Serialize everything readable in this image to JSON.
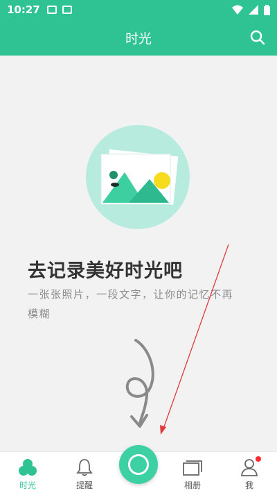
{
  "status_bar": {
    "time": "10:27",
    "icons": [
      "image-icon",
      "a-icon",
      "wifi-icon",
      "signal-icon",
      "battery-icon"
    ]
  },
  "app_bar": {
    "title": "时光",
    "search_icon": "search-icon"
  },
  "empty_state": {
    "illustration": "photo-placeholder-icon",
    "title": "去记录美好时光吧",
    "description": "一张张照片，一段文字，让你的记忆不再模糊"
  },
  "tabs": [
    {
      "label": "时光",
      "icon": "bubbles-icon",
      "active": true
    },
    {
      "label": "提醒",
      "icon": "bell-icon",
      "active": false
    },
    {
      "label": "相册",
      "icon": "album-icon",
      "active": false
    },
    {
      "label": "我",
      "icon": "person-icon",
      "active": false,
      "badge": true
    }
  ],
  "record_button": {
    "icon": "record-circle-icon"
  },
  "colors": {
    "primary": "#2fc293",
    "record": "#3dd0a2",
    "illustration_bg": "#b6ebdd",
    "mountain": "#3ecfa1",
    "sun": "#f7dc1d",
    "badge": "#ff2d2d",
    "annotation_arrow": "#e03a3a"
  }
}
